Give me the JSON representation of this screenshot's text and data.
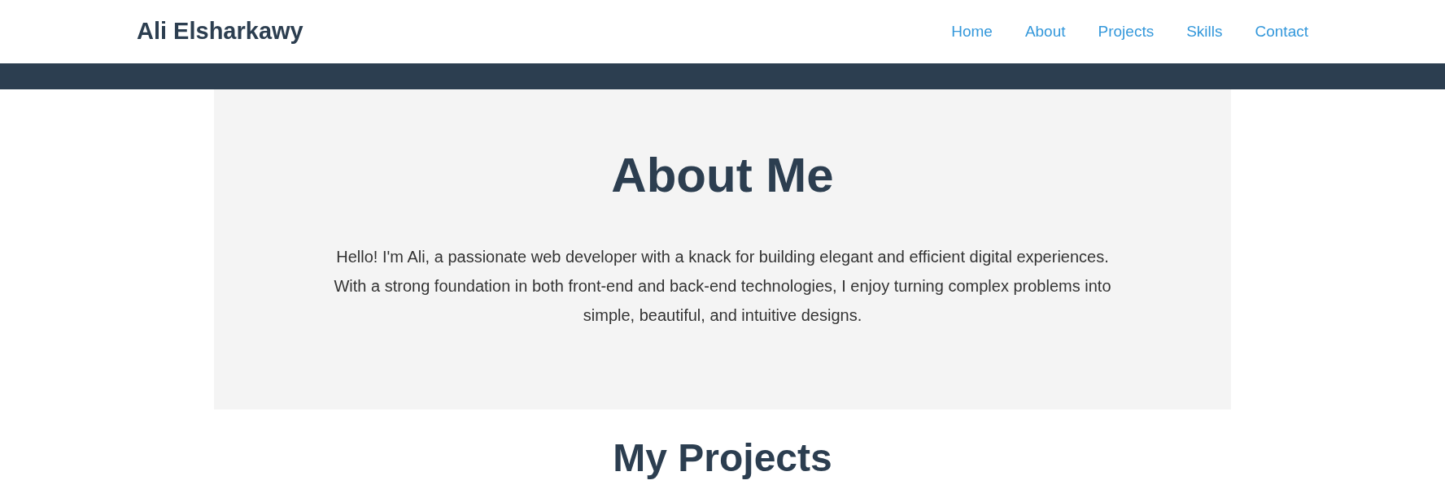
{
  "header": {
    "brand": "Ali Elsharkawy",
    "nav_links": [
      "Home",
      "About",
      "Projects",
      "Skills",
      "Contact"
    ]
  },
  "about": {
    "title": "About Me",
    "text": "Hello! I'm Ali, a passionate web developer with a knack for building elegant and efficient digital experiences. With a strong foundation in both front-end and back-end technologies, I enjoy turning complex problems into simple, beautiful, and intuitive designs."
  },
  "projects": {
    "title": "My Projects"
  }
}
